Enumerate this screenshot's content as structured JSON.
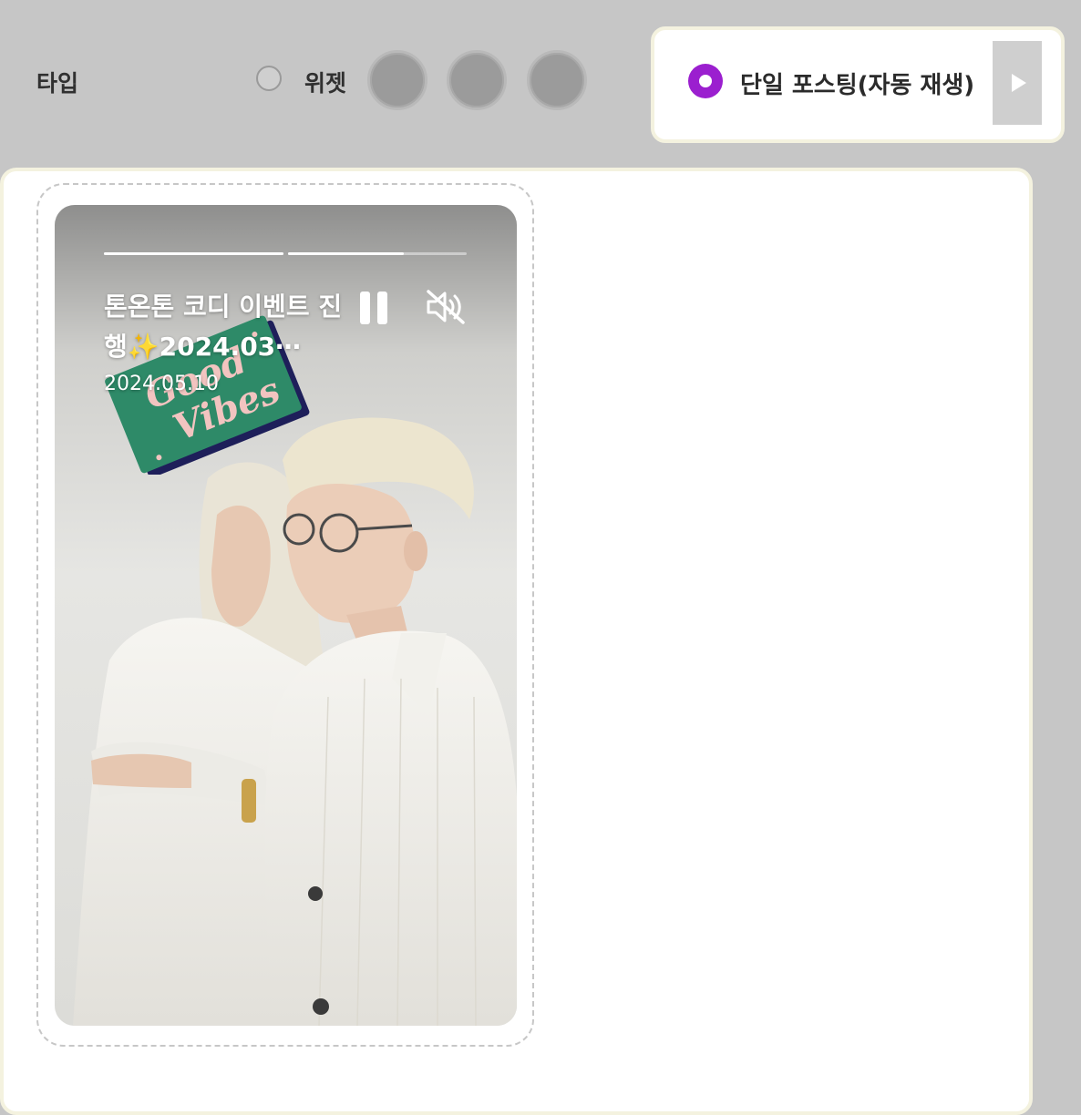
{
  "toolbar": {
    "type_label": "타입",
    "widget_label": "위젯",
    "swatches": [
      "#9b9b9b",
      "#9b9b9b",
      "#9b9b9b"
    ]
  },
  "option": {
    "label": "단일 포스팅(자동 재생)",
    "selected": true,
    "accent_color": "#9b1fcf",
    "play_icon": "play-icon"
  },
  "story": {
    "title": "톤온톤 코디 이벤트 진행✨2024.03⋯",
    "date": "2024.05.10",
    "progress": [
      1.0,
      0.65
    ],
    "controls": {
      "pause_icon": "pause-icon",
      "mute_icon": "speaker-muted-icon"
    },
    "sticker_text": [
      "Good",
      "Vibes"
    ]
  }
}
